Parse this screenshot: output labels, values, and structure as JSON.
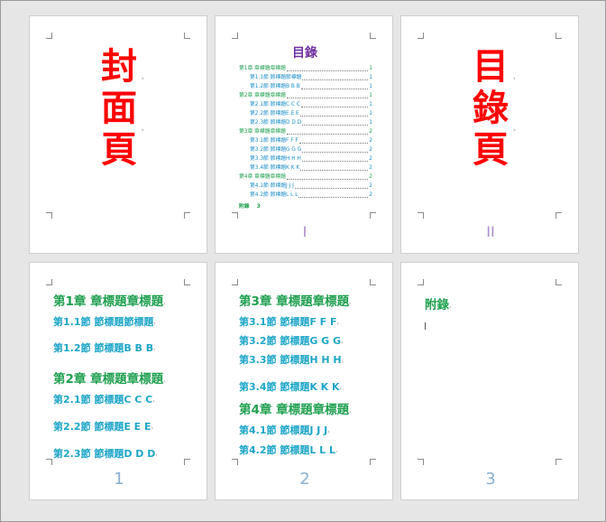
{
  "pages": {
    "cover": {
      "chars": [
        "封",
        "面",
        "頁"
      ]
    },
    "toc": {
      "title": "目錄",
      "entries": [
        {
          "level": "ch",
          "text": "第1章 章標題章標題",
          "page": "1"
        },
        {
          "level": "sec",
          "text": "第1.1節 節標題節標題",
          "page": "1"
        },
        {
          "level": "sec",
          "text": "第1.2節 節標題B B B",
          "page": "1"
        },
        {
          "level": "ch",
          "text": "第2章 章標題章標題",
          "page": "1"
        },
        {
          "level": "sec",
          "text": "第2.1節 節標題C C C",
          "page": "1"
        },
        {
          "level": "sec",
          "text": "第2.2節 節標題E E E",
          "page": "1"
        },
        {
          "level": "sec",
          "text": "第2.3節 節標題D D D",
          "page": "1"
        },
        {
          "level": "ch",
          "text": "第3章 章標題章標題",
          "page": "2"
        },
        {
          "level": "sec",
          "text": "第3.1節 節標題F F F",
          "page": "2"
        },
        {
          "level": "sec",
          "text": "第3.2節 節標題G G G",
          "page": "2"
        },
        {
          "level": "sec",
          "text": "第3.3節 節標題H H H",
          "page": "2"
        },
        {
          "level": "sec",
          "text": "第3.4節 節標題K K K",
          "page": "2"
        },
        {
          "level": "ch",
          "text": "第4章 章標題章標題",
          "page": "2"
        },
        {
          "level": "sec",
          "text": "第4.1節 節標題J J J",
          "page": "2"
        },
        {
          "level": "sec",
          "text": "第4.2節 節標題L L L",
          "page": "2"
        }
      ],
      "appendix": {
        "text": "附錄",
        "page": "3"
      },
      "page_label": "I"
    },
    "toc_cover": {
      "chars": [
        "目",
        "錄",
        "頁"
      ],
      "page_label": "II"
    },
    "page1": {
      "headings": [
        {
          "kind": "ch",
          "text": "第1章 章標題章標題"
        },
        {
          "kind": "sec",
          "text": "第1.1節 節標題節標題"
        },
        {
          "kind": "sec",
          "text": "第1.2節 節標題B B B"
        },
        {
          "kind": "ch",
          "text": "第2章 章標題章標題"
        },
        {
          "kind": "sec",
          "text": "第2.1節 節標題C C C"
        },
        {
          "kind": "sec",
          "text": "第2.2節 節標題E E E"
        },
        {
          "kind": "sec",
          "text": "第2.3節 節標題D D D"
        }
      ],
      "page_number": "1"
    },
    "page2": {
      "headings": [
        {
          "kind": "ch",
          "text": "第3章 章標題章標題"
        },
        {
          "kind": "sec",
          "text": "第3.1節 節標題F F F"
        },
        {
          "kind": "sec",
          "text": "第3.2節 節標題G G G"
        },
        {
          "kind": "sec",
          "text": "第3.3節 節標題H H H"
        },
        {
          "kind": "sec",
          "text": "第3.4節 節標題K K K"
        },
        {
          "kind": "ch",
          "text": "第4章 章標題章標題"
        },
        {
          "kind": "sec",
          "text": "第4.1節 節標題J J J"
        },
        {
          "kind": "sec",
          "text": "第4.2節 節標題L L L"
        }
      ],
      "page_number": "2"
    },
    "page3": {
      "heading": "附錄",
      "page_number": "3"
    }
  },
  "colors": {
    "cover_red": "#ff0000",
    "toc_title_purple": "#7030a0",
    "chapter_green": "#20a050",
    "section_cyan": "#1ea6c8",
    "page_number_blue": "#8aaed0",
    "roman_number_purple": "#a98ac9"
  }
}
